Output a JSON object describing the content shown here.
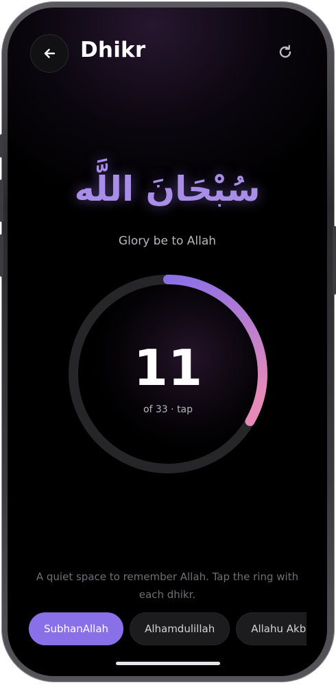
{
  "header": {
    "title": "Dhikr",
    "back_icon": "arrow-left-icon",
    "reset_icon": "refresh-icon"
  },
  "dhikr": {
    "arabic": "سُبْحَانَ اللَّه",
    "translation": "Glory be to Allah"
  },
  "counter": {
    "count": "11",
    "subtitle": "of 33 · tap",
    "progress": 0.3333
  },
  "helper_text": "A quiet space to remember Allah. Tap the ring with each dhikr.",
  "chips": [
    {
      "label": "SubhanAllah",
      "active": true
    },
    {
      "label": "Alhamdulillah",
      "active": false
    },
    {
      "label": "Allahu Akbar",
      "active": false
    }
  ],
  "colors": {
    "accent": "#8a70e8",
    "gradient_end": "#e58ab9",
    "background": "#000000"
  }
}
